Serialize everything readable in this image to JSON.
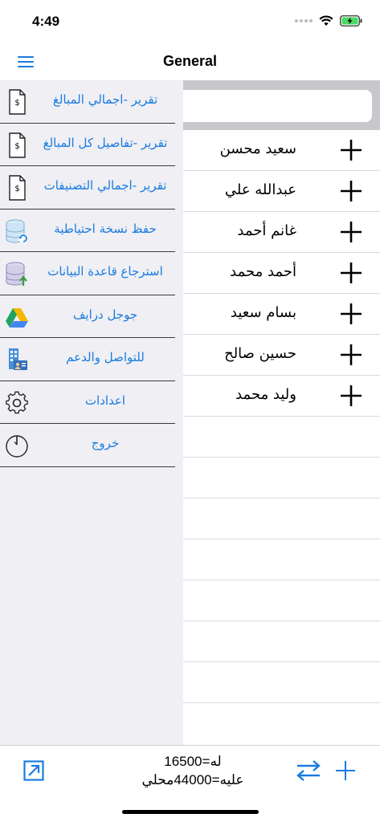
{
  "status_bar": {
    "time": "4:49"
  },
  "nav": {
    "title": "General",
    "menu_icon": "hamburger-menu-icon"
  },
  "search": {
    "placeholder": ""
  },
  "drawer": {
    "items": [
      {
        "label": "تقرير -اجمالي المبالغ",
        "icon": "report-document-icon"
      },
      {
        "label": "تقرير -تفاصيل كل المبالغ",
        "icon": "report-document-icon"
      },
      {
        "label": "تقرير -اجمالي التصنيفات",
        "icon": "report-document-icon"
      },
      {
        "label": "حفظ نسخة احتياطية",
        "icon": "database-backup-icon"
      },
      {
        "label": "استرجاع قاعدة البيانات",
        "icon": "database-restore-icon"
      },
      {
        "label": "جوجل درايف",
        "icon": "google-drive-icon"
      },
      {
        "label": "للتواصل والدعم",
        "icon": "contact-card-icon"
      },
      {
        "label": "اعدادات",
        "icon": "gear-icon"
      },
      {
        "label": "خروج",
        "icon": "power-icon"
      }
    ]
  },
  "list": {
    "rows": [
      {
        "name": "سعيد محسن"
      },
      {
        "name": "عبدالله علي"
      },
      {
        "name": "غانم أحمد"
      },
      {
        "name": "أحمد محمد"
      },
      {
        "name": "بسام سعيد"
      },
      {
        "name": "حسين صالح"
      },
      {
        "name": "وليد محمد"
      },
      {
        "name": ""
      },
      {
        "name": ""
      },
      {
        "name": ""
      },
      {
        "name": ""
      },
      {
        "name": ""
      },
      {
        "name": ""
      },
      {
        "name": ""
      }
    ]
  },
  "bottom": {
    "credit_total": "له=16500",
    "debit_total": "عليه=44000محلي"
  },
  "colors": {
    "accent": "#1a7be0",
    "drawer_bg": "#efeff4",
    "search_band": "#c8c8cc"
  }
}
